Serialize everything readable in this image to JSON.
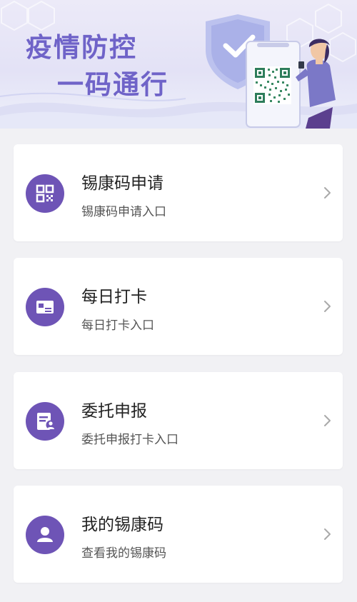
{
  "banner": {
    "title_line1": "疫情防控",
    "title_line2": "一码通行"
  },
  "colors": {
    "accent": "#6e54b6",
    "banner_title": "#6f63c8",
    "page_bg": "#f1f1f4",
    "card_bg": "#ffffff"
  },
  "menu": {
    "items": [
      {
        "title": "锡康码申请",
        "subtitle": "锡康码申请入口",
        "icon": "qr-code-icon"
      },
      {
        "title": "每日打卡",
        "subtitle": "每日打卡入口",
        "icon": "card-icon"
      },
      {
        "title": "委托申报",
        "subtitle": "委托申报打卡入口",
        "icon": "report-person-icon"
      },
      {
        "title": "我的锡康码",
        "subtitle": "查看我的锡康码",
        "icon": "user-icon"
      }
    ]
  }
}
